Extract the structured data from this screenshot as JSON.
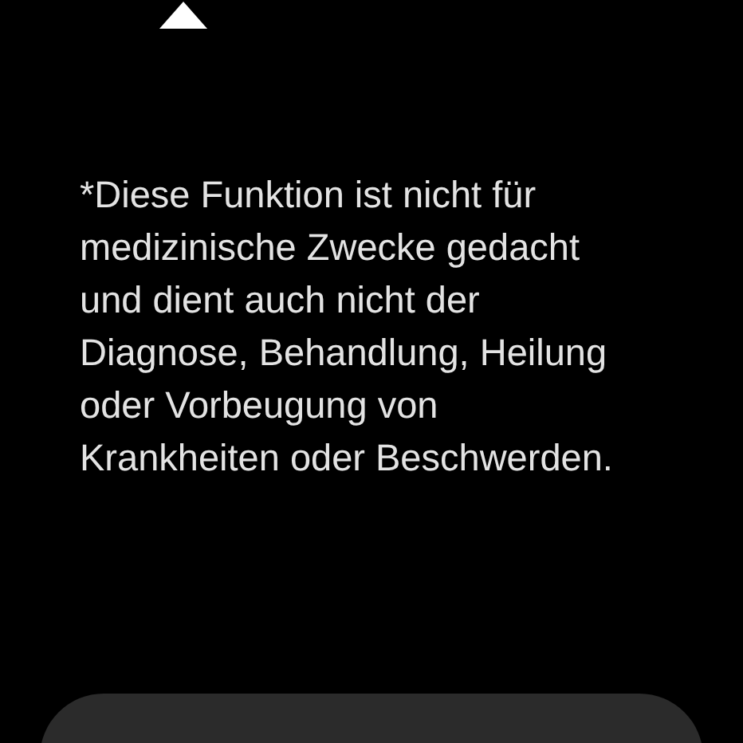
{
  "disclaimer": "*Diese Funktion ist nicht für medizinische Zwecke gedacht und dient auch nicht der Diagnose, Behandlung, Heilung oder Vorbeugung von Krankheiten oder Beschwerden."
}
